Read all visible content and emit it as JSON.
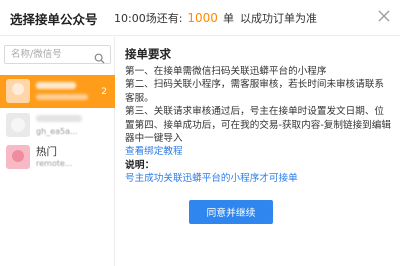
{
  "header": {
    "title": "选择接单公众号",
    "time_prefix": "10:00场还有:",
    "remaining_count": "1000",
    "unit": "单",
    "note": "以成功订单为准"
  },
  "sidebar": {
    "search_placeholder": "名称/微信号",
    "accounts": [
      {
        "name": "",
        "id": "",
        "badge": "2",
        "active": true
      },
      {
        "name": "",
        "id": "gh_ea5a...",
        "badge": "",
        "active": false
      },
      {
        "name": "热门",
        "id": "remote...",
        "badge": "",
        "active": false
      }
    ]
  },
  "content": {
    "heading": "接单要求",
    "step1": "第一、在接单需微信扫码关联迅蟒平台的小程序",
    "step2": "第二、扫码关联小程序，需客服审核，若长时间未审核请联系客服。",
    "step3": "第三、关联请求审核通过后，号主在接单时设置发文日期、位置第四、接单成功后，可在我的交易-获取内容-复制链接到编辑器中一键导入",
    "tutorial_link": "查看绑定教程",
    "note_heading": "说明：",
    "note_link": "号主成功关联迅蟒平台的小程序才可接单",
    "agree_button": "同意并继续"
  },
  "colors": {
    "accent_orange": "#ff9d1a",
    "count_orange": "#ff8a00",
    "link_blue": "#2b7de9",
    "button_blue": "#2f86ee"
  }
}
